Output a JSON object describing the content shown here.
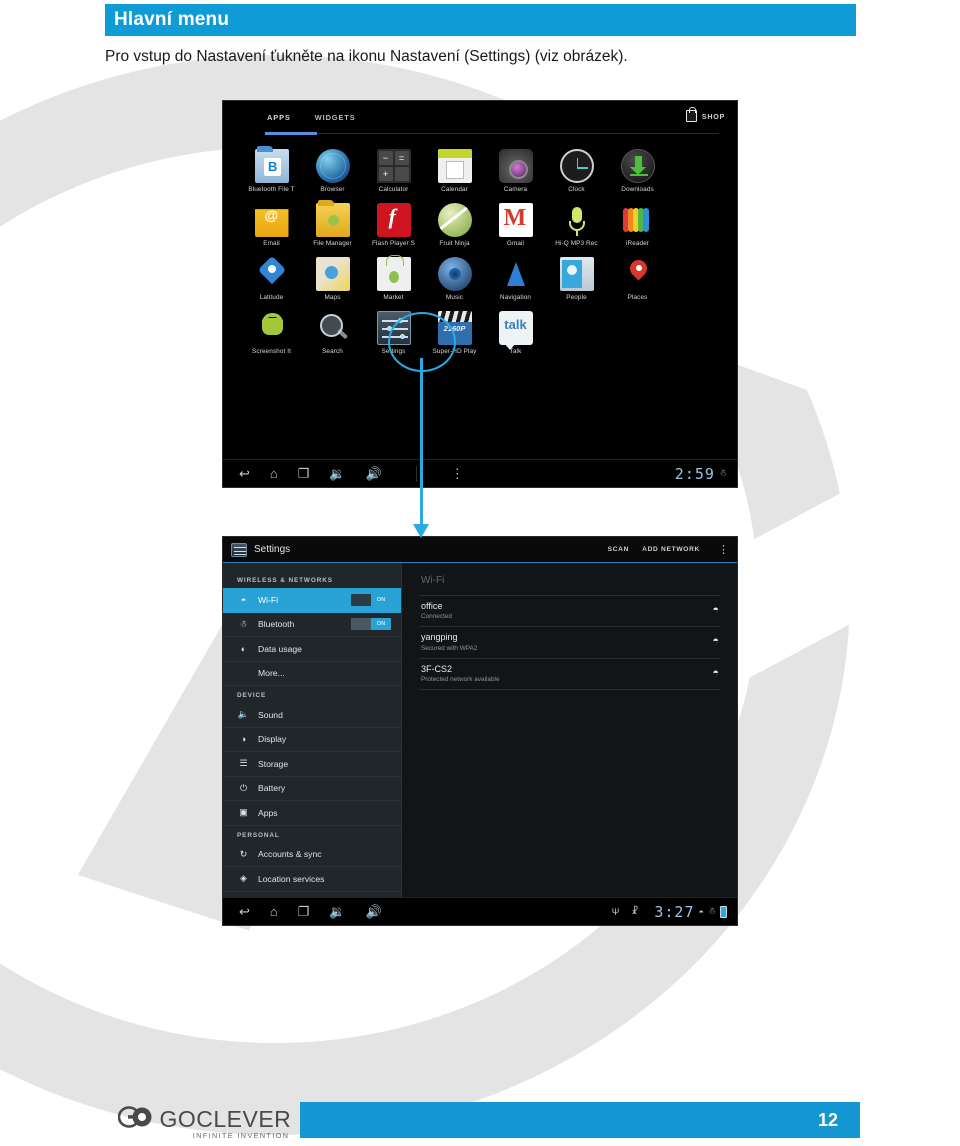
{
  "heading": {
    "title": "Hlavní menu"
  },
  "intro": {
    "text": "Pro vstup do Nastavení ťukněte na ikonu Nastavení (Settings) (viz obrázek)."
  },
  "colors": {
    "accent_blue": "#0e9bd6",
    "highlight_cyan": "#29abe2",
    "footer_bar": "#1496d2",
    "watermark_gray": "#e4e4e4"
  },
  "apps_screen": {
    "tabs": [
      {
        "label": "APPS",
        "selected": true
      },
      {
        "label": "WIDGETS",
        "selected": false
      }
    ],
    "shop_label": "SHOP",
    "shop_icon": "shopping-bag-icon",
    "rows": [
      [
        {
          "label": "Bluetooth File T",
          "icon": "bluetooth-folder-icon"
        },
        {
          "label": "Browser",
          "icon": "globe-icon"
        },
        {
          "label": "Calculator",
          "icon": "calculator-icon",
          "keys": [
            "−",
            "=",
            "+",
            ""
          ]
        },
        {
          "label": "Calendar",
          "icon": "calendar-icon"
        },
        {
          "label": "Camera",
          "icon": "camera-icon"
        },
        {
          "label": "Clock",
          "icon": "clock-icon"
        },
        {
          "label": "Downloads",
          "icon": "download-icon"
        }
      ],
      [
        {
          "label": "Email",
          "icon": "email-envelope-icon"
        },
        {
          "label": "File Manager",
          "icon": "file-folder-icon"
        },
        {
          "label": "Flash Player S",
          "icon": "flash-player-icon"
        },
        {
          "label": "Fruit Ninja",
          "icon": "fruit-ninja-icon"
        },
        {
          "label": "Gmail",
          "icon": "gmail-icon"
        },
        {
          "label": "Hi-Q MP3 Rec",
          "icon": "microphone-icon"
        },
        {
          "label": "iReader",
          "icon": "ireader-icon"
        }
      ],
      [
        {
          "label": "Latitude",
          "icon": "latitude-pin-icon"
        },
        {
          "label": "Maps",
          "icon": "maps-icon"
        },
        {
          "label": "Market",
          "icon": "market-bag-icon"
        },
        {
          "label": "Music",
          "icon": "music-speaker-icon"
        },
        {
          "label": "Navigation",
          "icon": "navigation-arrow-icon"
        },
        {
          "label": "People",
          "icon": "people-contact-icon"
        },
        {
          "label": "Places",
          "icon": "places-pin-icon"
        }
      ],
      [
        {
          "label": "Screenshot It",
          "icon": "android-robot-icon"
        },
        {
          "label": "Search",
          "icon": "magnifier-icon"
        },
        {
          "label": "Settings",
          "icon": "settings-sliders-icon",
          "highlighted": true
        },
        {
          "label": "Super-HD Play",
          "icon": "clapperboard-icon",
          "badge": "2160P"
        },
        {
          "label": "Talk",
          "icon": "talk-bubble-icon",
          "badge": "talk"
        }
      ]
    ],
    "navbar": {
      "buttons": [
        "back-icon",
        "home-icon",
        "recents-icon",
        "volume-down-icon",
        "volume-up-icon",
        "overflow-menu-icon"
      ],
      "clock": "2:59",
      "status_icons": [
        "bluetooth-icon"
      ]
    }
  },
  "settings_screen": {
    "app_icon": "settings-sliders-icon",
    "title": "Settings",
    "actions": [
      {
        "label": "SCAN"
      },
      {
        "label": "ADD NETWORK"
      }
    ],
    "overflow_icon": "overflow-menu-icon",
    "sidebar": [
      {
        "type": "group",
        "label": "WIRELESS & NETWORKS"
      },
      {
        "type": "item",
        "label": "Wi-Fi",
        "icon": "wifi-icon",
        "selected": true,
        "toggle": "ON"
      },
      {
        "type": "item",
        "label": "Bluetooth",
        "icon": "bluetooth-icon",
        "selected": false,
        "toggle": "ON"
      },
      {
        "type": "item",
        "label": "Data usage",
        "icon": "data-usage-icon",
        "selected": false
      },
      {
        "type": "item",
        "label": "More...",
        "icon": "",
        "selected": false,
        "indent": true
      },
      {
        "type": "group",
        "label": "DEVICE"
      },
      {
        "type": "item",
        "label": "Sound",
        "icon": "sound-icon",
        "selected": false
      },
      {
        "type": "item",
        "label": "Display",
        "icon": "display-icon",
        "selected": false
      },
      {
        "type": "item",
        "label": "Storage",
        "icon": "storage-icon",
        "selected": false
      },
      {
        "type": "item",
        "label": "Battery",
        "icon": "battery-icon",
        "selected": false
      },
      {
        "type": "item",
        "label": "Apps",
        "icon": "apps-icon",
        "selected": false
      },
      {
        "type": "group",
        "label": "PERSONAL"
      },
      {
        "type": "item",
        "label": "Accounts & sync",
        "icon": "sync-icon",
        "selected": false
      },
      {
        "type": "item",
        "label": "Location services",
        "icon": "location-icon",
        "selected": false
      }
    ],
    "pane_title": "Wi-Fi",
    "networks": [
      {
        "ssid": "office",
        "status": "Connected",
        "signal_icon": "wifi-signal-icon"
      },
      {
        "ssid": "yangping",
        "status": "Secured with WPA2",
        "signal_icon": "wifi-signal-lock-icon"
      },
      {
        "ssid": "3F-CS2",
        "status": "Protected network available",
        "signal_icon": "wifi-signal-icon"
      }
    ],
    "navbar": {
      "buttons": [
        "back-icon",
        "home-icon",
        "recents-icon",
        "volume-down-icon",
        "volume-up-icon"
      ],
      "clock": "3:27",
      "status_icons": [
        "usb-icon",
        "android-debug-icon",
        "wifi-icon",
        "bluetooth-icon",
        "battery-icon"
      ]
    }
  },
  "footer": {
    "brand_go": "GO",
    "brand_name": "GOCLEVER",
    "tagline": "INFINITE INVENTION",
    "page_number": "12"
  }
}
